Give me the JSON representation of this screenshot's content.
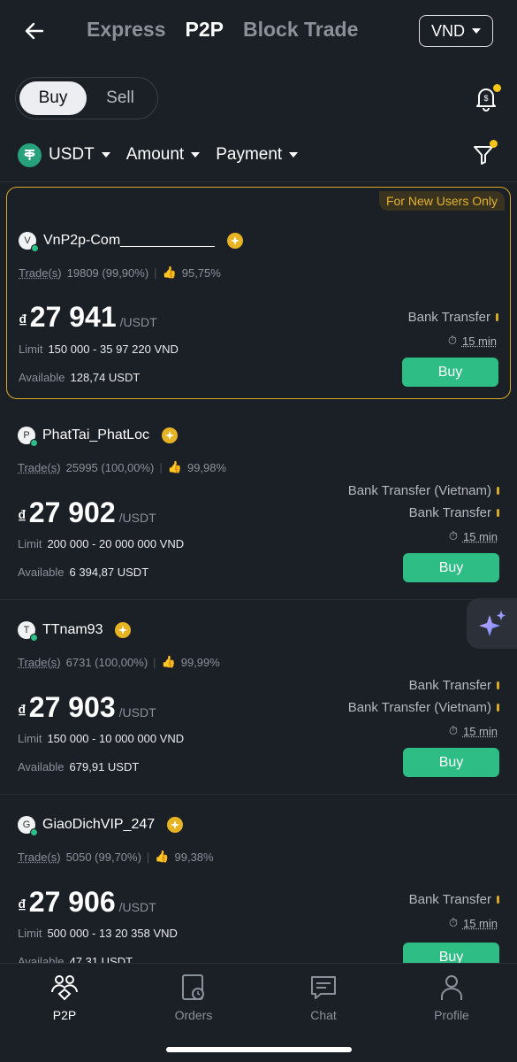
{
  "header": {
    "tabs": [
      {
        "label": "Express",
        "active": false
      },
      {
        "label": "P2P",
        "active": true
      },
      {
        "label": "Block Trade",
        "active": false
      }
    ],
    "currency": "VND"
  },
  "trade_toggle": {
    "buy": "Buy",
    "sell": "Sell",
    "selected": "Buy"
  },
  "filters": {
    "asset": "USDT",
    "amount": "Amount",
    "payment": "Payment"
  },
  "ads": [
    {
      "badge": "For New Users Only",
      "initial": "V",
      "merchant": "VnP2p-Com____________",
      "trades_label": "Trade(s)",
      "trades": "19809 (99,90%)",
      "rating": "95,75%",
      "currency_symbol": "₫",
      "price": "27 941",
      "unit": "/USDT",
      "limit_label": "Limit",
      "limit": "150 000 - 35 97 220 VND",
      "available_label": "Available",
      "available": "128,74 USDT",
      "payments": [
        "Bank Transfer"
      ],
      "time": "15 min",
      "button": "Buy"
    },
    {
      "initial": "P",
      "merchant": "PhatTai_PhatLoc",
      "trades_label": "Trade(s)",
      "trades": "25995 (100,00%)",
      "rating": "99,98%",
      "currency_symbol": "₫",
      "price": "27 902",
      "unit": "/USDT",
      "limit_label": "Limit",
      "limit": "200 000 - 20 000 000 VND",
      "available_label": "Available",
      "available": "6 394,87 USDT",
      "payments": [
        "Bank Transfer (Vietnam)",
        "Bank Transfer"
      ],
      "time": "15 min",
      "button": "Buy"
    },
    {
      "initial": "T",
      "merchant": "TTnam93",
      "trades_label": "Trade(s)",
      "trades": "6731 (100,00%)",
      "rating": "99,99%",
      "currency_symbol": "₫",
      "price": "27 903",
      "unit": "/USDT",
      "limit_label": "Limit",
      "limit": "150 000 - 10 000 000 VND",
      "available_label": "Available",
      "available": "679,91 USDT",
      "payments": [
        "Bank Transfer",
        "Bank Transfer (Vietnam)"
      ],
      "time": "15 min",
      "button": "Buy"
    },
    {
      "initial": "G",
      "merchant": "GiaoDichVIP_247",
      "trades_label": "Trade(s)",
      "trades": "5050 (99,70%)",
      "rating": "99,38%",
      "currency_symbol": "₫",
      "price": "27 906",
      "unit": "/USDT",
      "limit_label": "Limit",
      "limit": "500 000 - 13 20 358 VND",
      "available_label": "Available",
      "available": "47,31 USDT",
      "payments": [
        "Bank Transfer"
      ],
      "time": "15 min",
      "button": "Buy"
    }
  ],
  "tabbar": [
    {
      "label": "P2P",
      "icon": "p2p-icon",
      "active": true
    },
    {
      "label": "Orders",
      "icon": "orders-icon",
      "active": false
    },
    {
      "label": "Chat",
      "icon": "chat-icon",
      "active": false
    },
    {
      "label": "Profile",
      "icon": "profile-icon",
      "active": false
    }
  ],
  "colors": {
    "accent": "#2ebd85",
    "highlight": "#d9a927",
    "background": "#1b1f26"
  }
}
